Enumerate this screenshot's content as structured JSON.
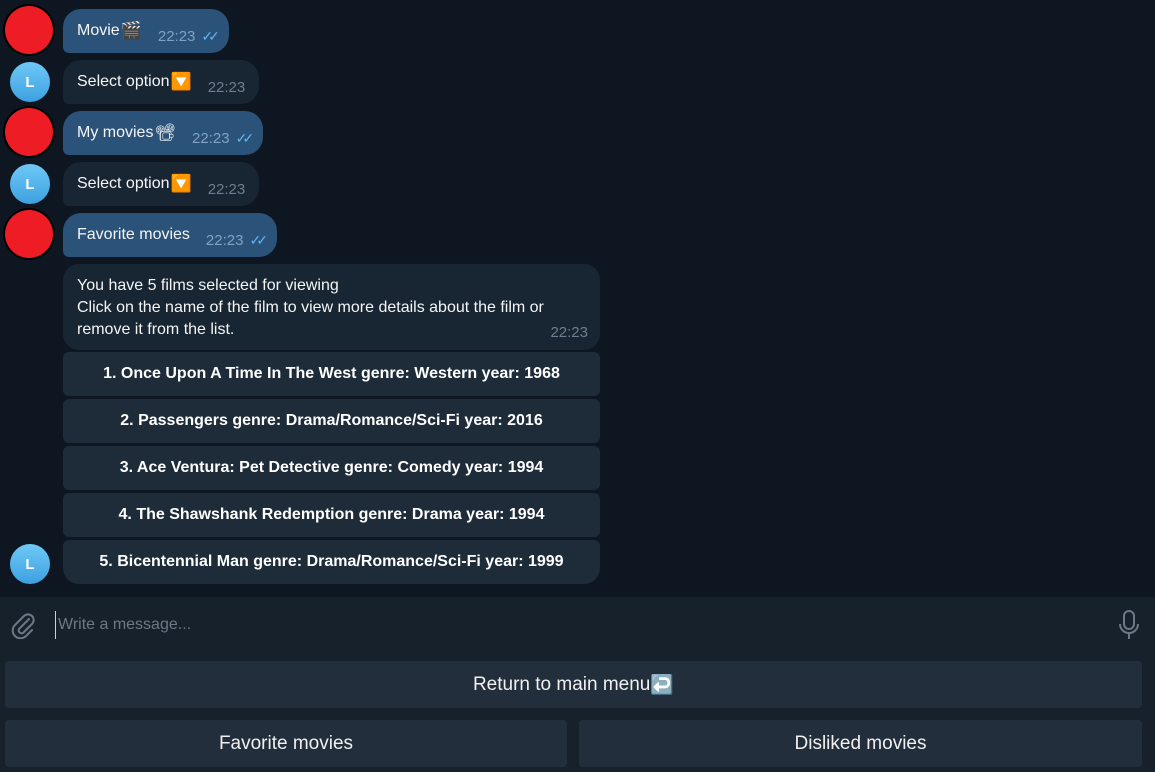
{
  "messages": [
    {
      "text": "Movie",
      "emoji": "🎬",
      "time": "22:23",
      "read": "✓✓"
    },
    {
      "text": "Select option",
      "emoji": "🔽",
      "time": "22:23"
    },
    {
      "text": "My movies",
      "emoji": "📽",
      "time": "22:23",
      "read": "✓✓"
    },
    {
      "text": "Select option",
      "emoji": "🔽",
      "time": "22:23"
    },
    {
      "text": "Favorite movies",
      "time": "22:23",
      "read": "✓✓"
    }
  ],
  "bot_avatar_letter": "L",
  "bot_reply": {
    "line1": "You have 5 films selected for viewing",
    "line2": "Click on the name of the film to view more details about the film or remove it from the list.",
    "time": "22:23"
  },
  "film_buttons": [
    "1. Once Upon A Time In The West genre: Western  year: 1968",
    "2. Passengers genre: Drama/Romance/Sci-Fi  year: 2016",
    "3. Ace Ventura: Pet Detective genre: Comedy  year: 1994",
    "4.  The Shawshank Redemption genre: Drama  year: 1994",
    "5. Bicentennial Man genre: Drama/Romance/Sci-Fi  year: 1999"
  ],
  "composer": {
    "placeholder": "Write a message..."
  },
  "keyboard": {
    "return_label": "Return to main menu",
    "return_emoji": "↩️",
    "favorite_label": "Favorite movies",
    "disliked_label": "Disliked movies"
  },
  "icons": {
    "attach": "paperclip-icon",
    "mic": "microphone-icon"
  }
}
